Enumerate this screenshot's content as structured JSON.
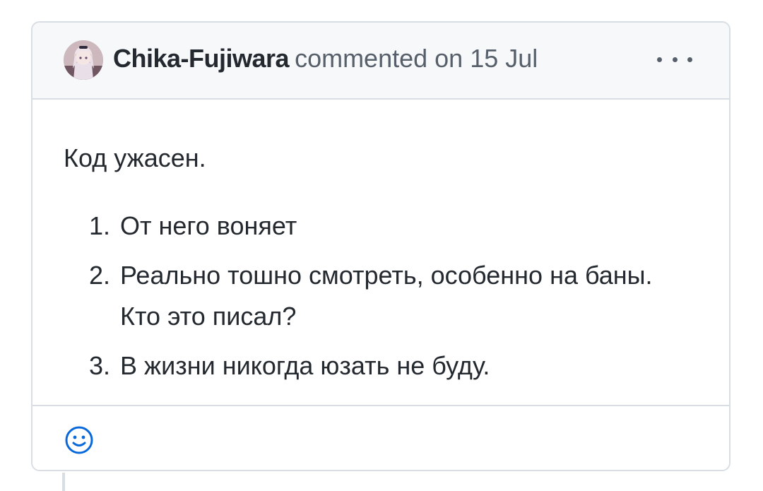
{
  "comment": {
    "author": "Chika-Fujiwara",
    "action_text": "commented on 15 Jul",
    "menu_icon": "kebab-horizontal-icon",
    "avatar_icon": "avatar-image",
    "body": {
      "intro": "Код ужасен.",
      "points": [
        "От него воняет",
        "Реально тошно смотреть, особенно на баны. Кто это писал?",
        "В жизни никогда юзать не буду."
      ]
    },
    "footer": {
      "reaction_icon": "smiley-icon"
    }
  },
  "colors": {
    "border": "#d8dee4",
    "header_bg": "#f6f8fa",
    "text": "#24292f",
    "muted": "#57606a",
    "accent": "#0969da"
  }
}
